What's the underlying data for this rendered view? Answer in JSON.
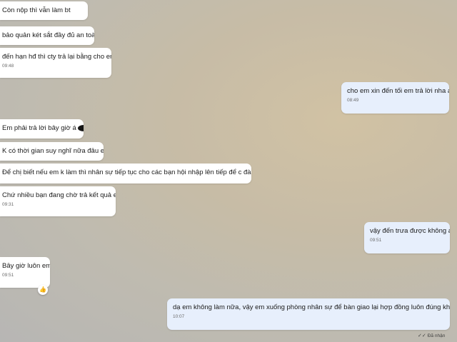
{
  "messages": [
    {
      "text": "Còn nộp thì vẫn làm bt",
      "time": ""
    },
    {
      "text": "bảo quản két sắt đầy đủ an toàn",
      "time": ""
    },
    {
      "text": "đến hạn hđ thì cty trả lại bằng cho em",
      "time": "09:48"
    },
    {
      "text": "cho em xin đến tối em trả lời nha a",
      "time": "08:49"
    },
    {
      "text": "Em phải trả lời bây giờ á",
      "time": ""
    },
    {
      "text": "K có thời gian suy nghĩ nữa đâu em",
      "time": ""
    },
    {
      "text": "Để chị biết nếu em k làm thì nhân sự tiếp tục cho các bạn hội nhập lên tiếp để c đào tạo",
      "time": ""
    },
    {
      "text": "Chứ nhiều bạn đang chờ trả kết quả em",
      "time": "09:31"
    },
    {
      "text": "vậy đến trưa được không a",
      "time": "09:51"
    },
    {
      "text": "Bây giờ luôn em",
      "time": "09:51"
    },
    {
      "text": "dạ em không làm nữa, vậy em xuống phòng nhân sự để bàn giao lại hợp đồng luôn đúng không a",
      "time": "10:07"
    }
  ],
  "reaction_icon": "thumbs-up-icon",
  "status": {
    "label": "Đã nhận",
    "icon": "double-check-icon"
  },
  "colors": {
    "incoming": "#ffffff",
    "outgoing": "#e7effc"
  }
}
